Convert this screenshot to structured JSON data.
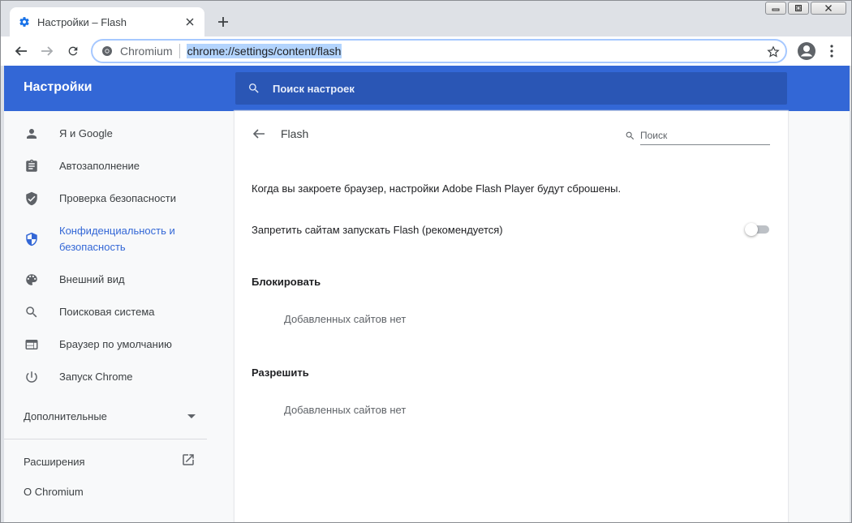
{
  "tab": {
    "title": "Настройки – Flash",
    "close": "×"
  },
  "toolbar": {
    "site_name": "Chromium",
    "url": "chrome://settings/content/flash"
  },
  "header": {
    "title": "Настройки",
    "search_placeholder": "Поиск настроек"
  },
  "sidebar": {
    "items": [
      {
        "label": "Я и Google",
        "icon": "person-icon"
      },
      {
        "label": "Автозаполнение",
        "icon": "clipboard-icon"
      },
      {
        "label": "Проверка безопасности",
        "icon": "shield-check-icon"
      },
      {
        "label": "Конфиденциальность и",
        "label2": "безопасность",
        "icon": "shield-privacy-icon",
        "active": true
      },
      {
        "label": "Внешний вид",
        "icon": "palette-icon"
      },
      {
        "label": "Поисковая система",
        "icon": "search-icon"
      },
      {
        "label": "Браузер по умолчанию",
        "icon": "browser-icon"
      },
      {
        "label": "Запуск Chrome",
        "icon": "power-icon"
      }
    ],
    "advanced": "Дополнительные",
    "extensions": "Расширения",
    "about": "О Chromium"
  },
  "page": {
    "title": "Flash",
    "search_placeholder": "Поиск",
    "notice": "Когда вы закроете браузер, настройки Adobe Flash Player будут сброшены.",
    "block_flash_label": "Запретить сайтам запускать Flash (рекомендуется)",
    "block_flash_enabled": false,
    "block_heading": "Блокировать",
    "block_empty": "Добавленных сайтов нет",
    "allow_heading": "Разрешить",
    "allow_empty": "Добавленных сайтов нет"
  },
  "colors": {
    "accent": "#3367d6",
    "header_search_bg": "#2a56b5",
    "content_bg": "#f8f9fa",
    "chrome_frame": "#dee1e6"
  }
}
